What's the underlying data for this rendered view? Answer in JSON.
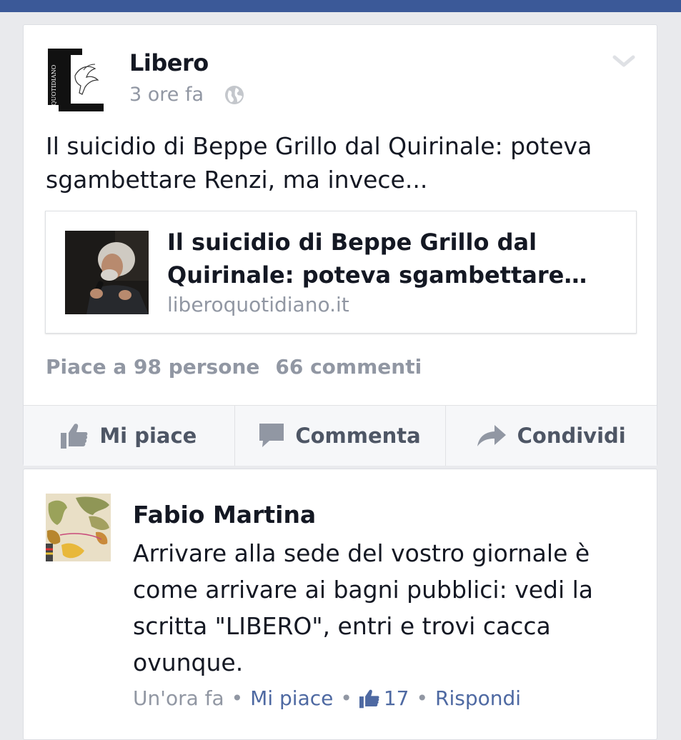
{
  "post": {
    "page_name": "Libero",
    "logo_text": "QUOTIDIANO",
    "time": "3 ore fa",
    "text": "Il suicidio di Beppe Grillo dal Quirinale: poteva sgambettare Renzi, ma invece...",
    "link": {
      "title": "Il suicidio di Beppe Grillo dal Quirinale: poteva sgambettare…",
      "domain": "liberoquotidiano.it"
    },
    "likes_text": "Piace a 98 persone",
    "comments_text": "66 commenti",
    "actions": {
      "like": "Mi piace",
      "comment": "Commenta",
      "share": "Condividi"
    }
  },
  "comment": {
    "author": "Fabio Martina",
    "text": "Arrivare alla sede del vostro giornale è come arrivare ai bagni pubblici: vedi la scritta \"LIBERO\", entri e trovi cacca ovunque.",
    "time": "Un'ora fa",
    "separator": "•",
    "like_label": "Mi piace",
    "like_count": "17",
    "reply_label": "Rispondi"
  },
  "colors": {
    "facebook_blue": "#3b5998",
    "meta_grey": "#9197a3",
    "link_blue": "#4e69a2"
  }
}
